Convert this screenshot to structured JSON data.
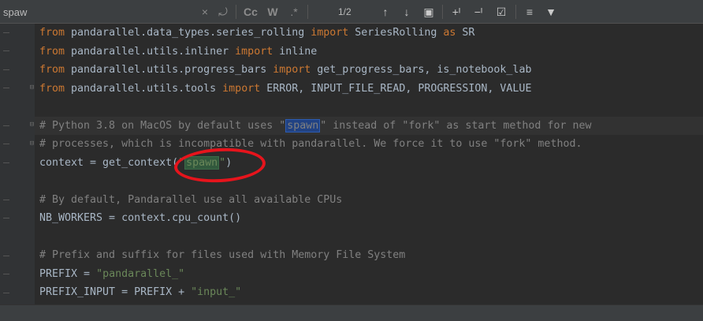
{
  "find_bar": {
    "query": "spaw",
    "match_counter": "1/2",
    "clear_icon": "×",
    "replace_history_icon": "⤾",
    "match_case_label": "Cc",
    "whole_words_label": "W",
    "regex_label": ".*",
    "prev_icon": "↑",
    "next_icon": "↓",
    "select_all_icon": "▣",
    "add_occurrence_icon": "+ᴵ",
    "remove_occurrence_icon": "−ᴵ",
    "select_all_occ_icon": "☑",
    "filter_settings_icon": "≡",
    "filter_icon": "▼"
  },
  "code_lines": [
    {
      "segments": [
        {
          "t": "from ",
          "c": "kw"
        },
        {
          "t": "pandarallel.data_types.series_rolling ",
          "c": "id"
        },
        {
          "t": "import ",
          "c": "kw"
        },
        {
          "t": "SeriesRolling ",
          "c": "id"
        },
        {
          "t": "as ",
          "c": "kw"
        },
        {
          "t": "SR",
          "c": "id"
        }
      ]
    },
    {
      "segments": [
        {
          "t": "from ",
          "c": "kw"
        },
        {
          "t": "pandarallel.utils.inliner ",
          "c": "id"
        },
        {
          "t": "import ",
          "c": "kw"
        },
        {
          "t": "inline",
          "c": "id"
        }
      ]
    },
    {
      "segments": [
        {
          "t": "from ",
          "c": "kw"
        },
        {
          "t": "pandarallel.utils.progress_bars ",
          "c": "id"
        },
        {
          "t": "import ",
          "c": "kw"
        },
        {
          "t": "get_progress_bars, is_notebook_lab",
          "c": "id"
        }
      ]
    },
    {
      "segments": [
        {
          "t": "from ",
          "c": "kw"
        },
        {
          "t": "pandarallel.utils.tools ",
          "c": "id"
        },
        {
          "t": "import ",
          "c": "kw"
        },
        {
          "t": "ERROR, INPUT_FILE_READ, PROGRESSION, VALUE",
          "c": "id"
        }
      ]
    },
    {
      "segments": []
    },
    {
      "segments": [
        {
          "t": "# Python 3.8 on MacOS by default uses \"",
          "c": "cmt"
        },
        {
          "t": "spawn",
          "c": "cmt match-current"
        },
        {
          "t": "\" instead of \"fork\" as start method for new",
          "c": "cmt"
        }
      ]
    },
    {
      "segments": [
        {
          "t": "# processes, which is incompatible with pandarallel. We force it to use \"fork\" method.",
          "c": "cmt"
        }
      ]
    },
    {
      "segments": [
        {
          "t": "context = get_context(",
          "c": "id"
        },
        {
          "t": "\"",
          "c": "str"
        },
        {
          "t": "spawn",
          "c": "str match"
        },
        {
          "t": "\"",
          "c": "str"
        },
        {
          "t": ")",
          "c": "id"
        }
      ]
    },
    {
      "segments": []
    },
    {
      "segments": [
        {
          "t": "# By default, Pandarallel use all available CPUs",
          "c": "cmt"
        }
      ]
    },
    {
      "segments": [
        {
          "t": "NB_WORKERS = context.cpu_count()",
          "c": "id"
        }
      ]
    },
    {
      "segments": []
    },
    {
      "segments": [
        {
          "t": "# Prefix and suffix for files used with Memory File System",
          "c": "cmt"
        }
      ]
    },
    {
      "segments": [
        {
          "t": "PREFIX = ",
          "c": "id"
        },
        {
          "t": "\"pandarallel_\"",
          "c": "str"
        }
      ]
    },
    {
      "segments": [
        {
          "t": "PREFIX_INPUT = PREFIX + ",
          "c": "id"
        },
        {
          "t": "\"input_\"",
          "c": "str"
        }
      ]
    }
  ],
  "colors": {
    "background": "#2b2b2b",
    "keyword": "#cc7832",
    "string": "#6a8759",
    "comment": "#808080",
    "identifier": "#a9b7c6",
    "search_match": "#32593d",
    "current_match": "#214283",
    "annotation": "#e6141c"
  }
}
